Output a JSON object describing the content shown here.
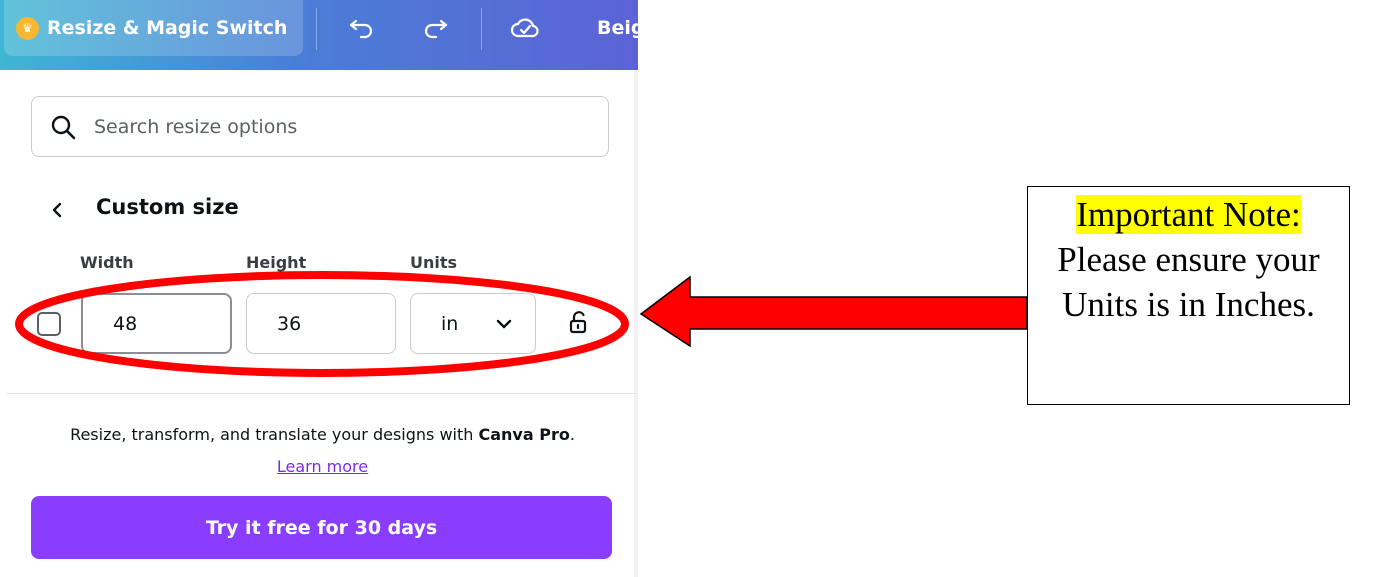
{
  "toolbar": {
    "resize_label": "Resize & Magic Switch",
    "doc_title": "Beig",
    "crown_icon": "crown-icon",
    "undo_icon": "undo-icon",
    "redo_icon": "redo-icon",
    "cloud_icon": "cloud-saved-icon"
  },
  "search": {
    "placeholder": "Search resize options"
  },
  "custom_size": {
    "title": "Custom size",
    "width_label": "Width",
    "height_label": "Height",
    "units_label": "Units",
    "width_value": "48",
    "height_value": "36",
    "units_value": "in"
  },
  "promo": {
    "text": "Resize, transform, and translate your designs with ",
    "brand": "Canva Pro",
    "period": ".",
    "learn_more": "Learn more",
    "cta": "Try it free for 30 days"
  },
  "note": {
    "heading": "Important Note:",
    "body": "Please ensure your Units is in Inches."
  },
  "colors": {
    "cta": "#8b3dff",
    "highlight": "#ffff00",
    "annotation_red": "#ff0000"
  }
}
